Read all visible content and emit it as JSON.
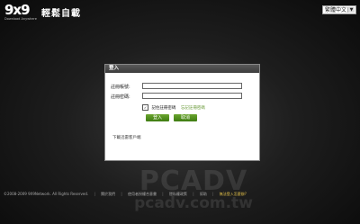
{
  "header": {
    "logo_text": "9x9",
    "logo_tagline": "Download Anywhere",
    "site_title": "輕鬆自載",
    "language": "繁體中文"
  },
  "login": {
    "title": "登入",
    "account_label": "註冊帳號:",
    "account_value": "",
    "password_label": "註冊密碼:",
    "password_value": "",
    "remember_label": "記住註冊密碼",
    "remember_checked": "✓",
    "forgot_link": "忘記註冊密碼",
    "submit_button": "登入",
    "cancel_button": "取消",
    "download_client": "下載迅雷客戶端"
  },
  "footer": {
    "copyright": "©2008-2009 9X9Network. All Rights Reserved.",
    "links": [
      "關於我們",
      "使用者授權合意書",
      "隱私權政策",
      "幫助"
    ],
    "highlight": "無法登入怎麼辦?"
  },
  "watermark": {
    "line1": "PCADV",
    "line2": "pcadv.com.tw"
  }
}
